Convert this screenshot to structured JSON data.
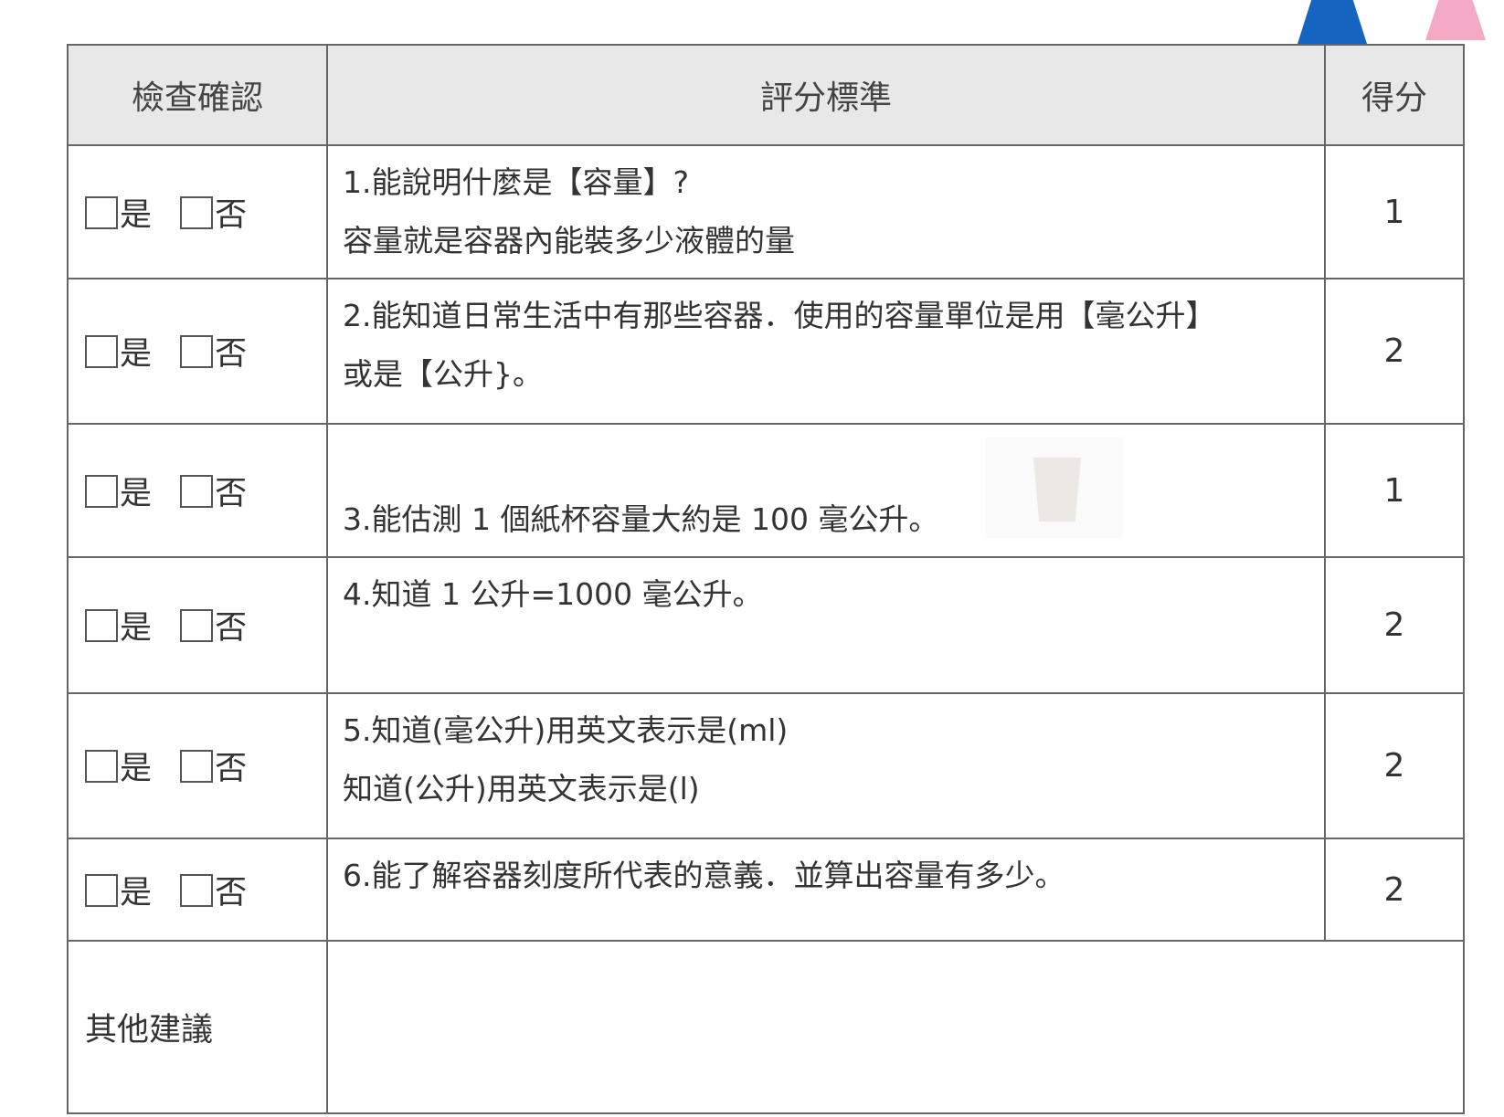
{
  "header": {
    "check": "檢查確認",
    "criteria": "評分標準",
    "score": "得分"
  },
  "options": {
    "yes": "是",
    "no": "否"
  },
  "rows": [
    {
      "lines": [
        "1.能說明什麼是【容量】?",
        "容量就是容器內能裝多少液體的量"
      ],
      "score": "1"
    },
    {
      "lines": [
        "2.能知道日常生活中有那些容器．使用的容量單位是用【毫公升】",
        "或是【公升}。"
      ],
      "score": "2"
    },
    {
      "lines": [
        "",
        "3.能估測 1 個紙杯容量大約是 100 毫公升。"
      ],
      "score": "1"
    },
    {
      "lines": [
        "4.知道 1 公升=1000 毫公升。",
        ""
      ],
      "score": "2"
    },
    {
      "lines": [
        "5.知道(毫公升)用英文表示是(ml)",
        "知道(公升)用英文表示是(l)"
      ],
      "score": "2"
    },
    {
      "lines": [
        "6.能了解容器刻度所代表的意義．並算出容量有多少。"
      ],
      "score": "2"
    }
  ],
  "other": {
    "label": "其他建議",
    "value": ""
  }
}
